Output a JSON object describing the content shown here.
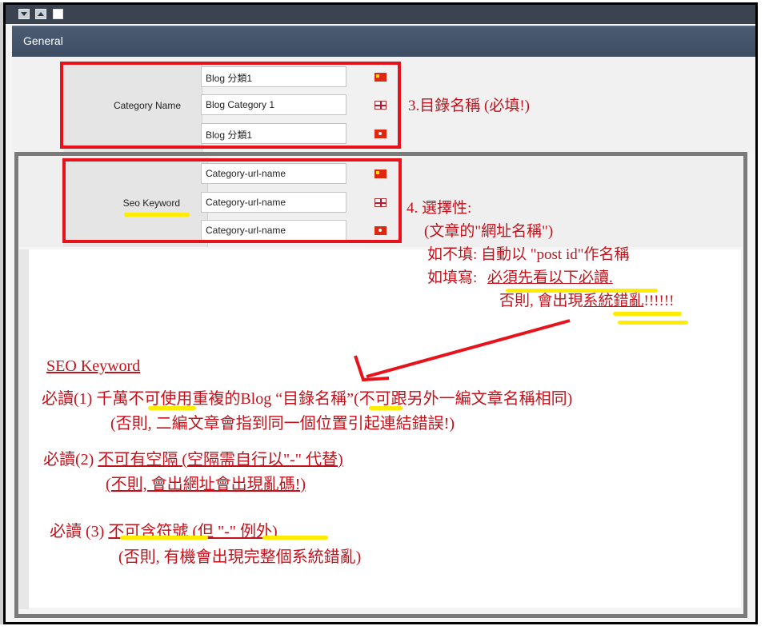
{
  "window": {
    "controls": [
      "chevron-down-icon",
      "chevron-up-icon",
      "checkbox"
    ]
  },
  "panel": {
    "title": "General"
  },
  "category_field": {
    "label": "Category Name",
    "values": [
      "Blog 分類1",
      "Blog Category 1",
      "Blog 分類1"
    ],
    "flags": [
      "flag-cn-icon",
      "flag-uk-icon",
      "flag-hk-icon"
    ]
  },
  "seo_field": {
    "label": "Seo Keyword",
    "values": [
      "Category-url-name",
      "Category-url-name",
      "Category-url-name"
    ],
    "flags": [
      "flag-cn-icon",
      "flag-uk-icon",
      "flag-hk-icon"
    ]
  },
  "annotations": {
    "note3": "3.目錄名稱 (必填!)",
    "note4": {
      "line1": "4. 選擇性:",
      "line2": "(文章的\"網址名稱\")",
      "line3": "如不填: 自動以 \"post id\"作名稱",
      "line4_prefix": "如填寫: ",
      "line4_underlined": "必須先看以下必讀.",
      "line5_prefix": "否則, 會出現",
      "line5_underlined": "系統錯亂",
      "line5_suffix": "!!!!!!"
    },
    "seo_title": "SEO Keyword",
    "rule1": {
      "prefix": "必讀(1) 千萬",
      "underlined1": "不可使用重複",
      "middle": "的Blog “目錄",
      "underlined2": "名稱",
      "suffix": "”(不可跟另外一編文章名稱相同)",
      "line2": "(否則, 二編文章會指到同一個位置引起連結錯誤!)"
    },
    "rule2": {
      "prefix": "必讀(2) ",
      "underlined": "不可有空隔 (空隔需自行以\"-\" 代替)",
      "line2": "(不則, 會出網址會出現亂碼!)"
    },
    "rule3": {
      "prefix": "必讀 (3) ",
      "underlined": "不可含符號 (但 \"-\" 例外)",
      "line2": "(否則, 有機會出現完整個系統錯亂)"
    }
  },
  "colors": {
    "annotation_red": "#e8121b",
    "highlight_yellow": "#ffec00",
    "header_bg": "#3d4d63"
  }
}
